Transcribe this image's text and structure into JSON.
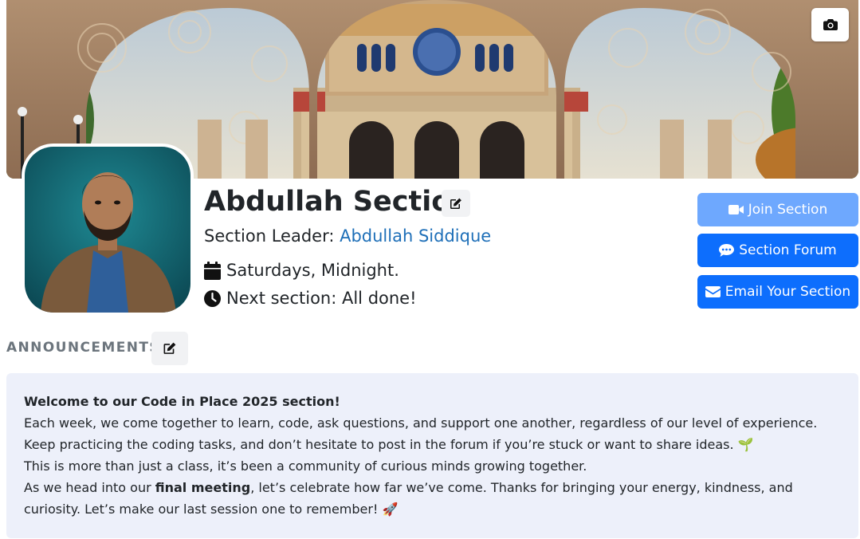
{
  "banner": {
    "camera_icon": "camera-icon"
  },
  "section": {
    "title": "Abdullah Section",
    "leader_prefix": "Section Leader: ",
    "leader_name": "Abdullah Siddique",
    "schedule": "Saturdays, Midnight.",
    "next_section": "Next section: All done!"
  },
  "actions": {
    "join": "Join Section",
    "forum": "Section Forum",
    "email": "Email Your Section"
  },
  "announcements": {
    "heading": "ANNOUNCEMENTS",
    "welcome": "Welcome to our Code in Place 2025 section!",
    "line1": "Each week, we come together to learn, code, ask questions, and support one another, regardless of our level of experience.",
    "line2": "Keep practicing the coding tasks, and don’t hesitate to post in the forum if you’re stuck or want to share ideas. 🌱",
    "line3": "This is more than just a class, it’s been a community of curious minds growing together.",
    "line4_pre": "As we head into our ",
    "line4_bold": "final meeting",
    "line4_post": ", let’s celebrate how far we’ve come. Thanks for bringing your energy, kindness, and",
    "line5": "curiosity. Let’s make our last session one to remember! 🚀"
  },
  "colors": {
    "primary": "#0d6efd",
    "primary_light": "#6ea8fe",
    "link": "#1e6fb8",
    "announcement_bg": "#edf0fa"
  }
}
